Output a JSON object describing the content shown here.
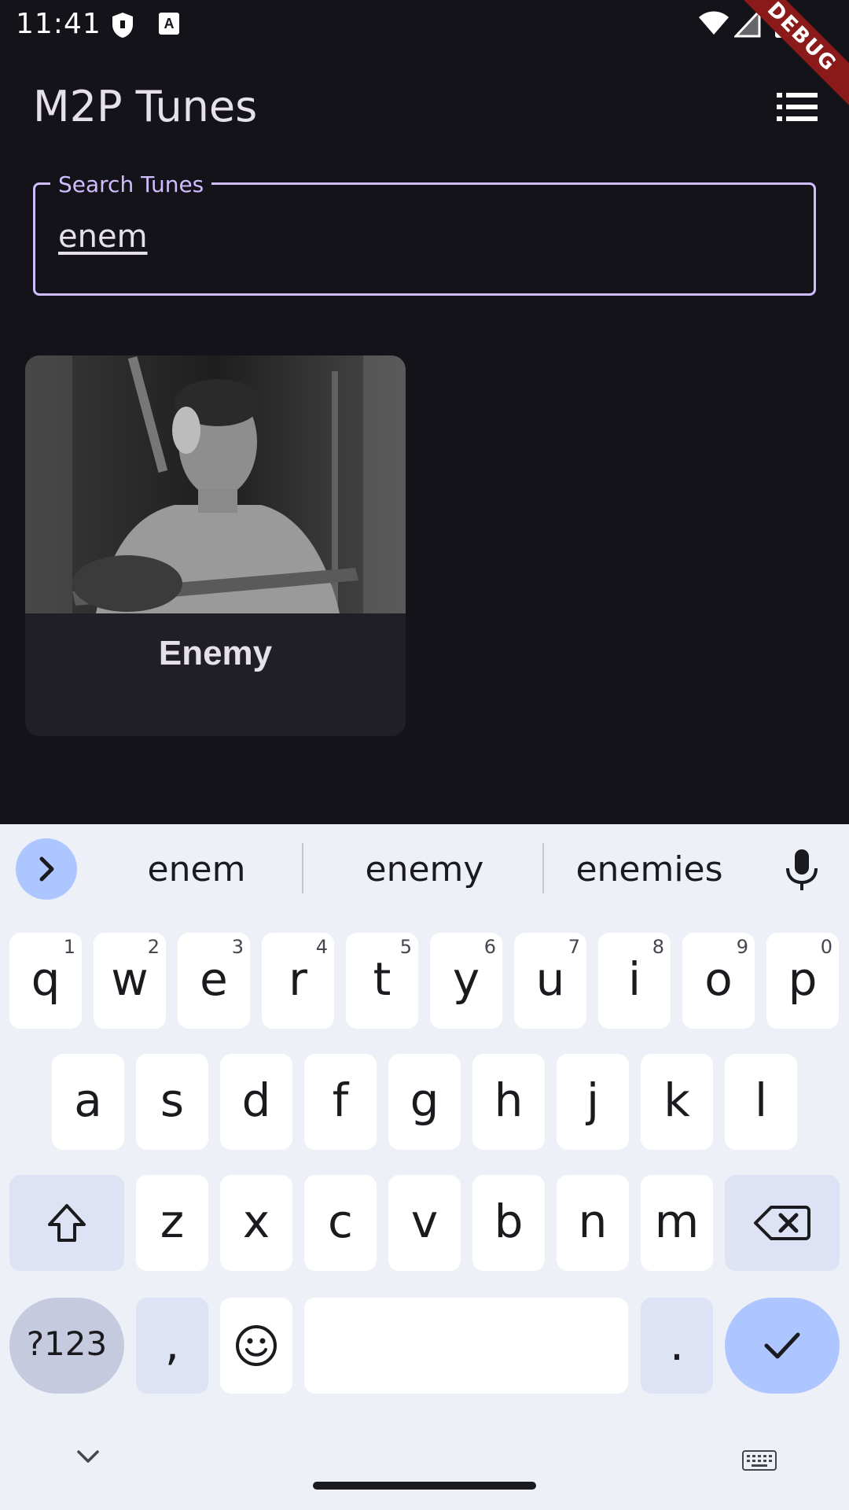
{
  "status_bar": {
    "time": "11:41",
    "debug_label": "DEBUG"
  },
  "app": {
    "title": "M2P Tunes"
  },
  "search": {
    "label": "Search Tunes",
    "value": "enem"
  },
  "results": [
    {
      "title": "Enemy"
    }
  ],
  "keyboard": {
    "suggestions": [
      "enem",
      "enemy",
      "enemies"
    ],
    "row1": [
      {
        "key": "q",
        "hint": "1"
      },
      {
        "key": "w",
        "hint": "2"
      },
      {
        "key": "e",
        "hint": "3"
      },
      {
        "key": "r",
        "hint": "4"
      },
      {
        "key": "t",
        "hint": "5"
      },
      {
        "key": "y",
        "hint": "6"
      },
      {
        "key": "u",
        "hint": "7"
      },
      {
        "key": "i",
        "hint": "8"
      },
      {
        "key": "o",
        "hint": "9"
      },
      {
        "key": "p",
        "hint": "0"
      }
    ],
    "row2": [
      "a",
      "s",
      "d",
      "f",
      "g",
      "h",
      "j",
      "k",
      "l"
    ],
    "row3": [
      "z",
      "x",
      "c",
      "v",
      "b",
      "n",
      "m"
    ],
    "symbols_label": "?123",
    "comma_label": ",",
    "period_label": "."
  },
  "colors": {
    "accent": "#cfbdfe",
    "background": "#15131a",
    "card": "#211f26",
    "debug_ribbon": "#8b1a1a"
  }
}
